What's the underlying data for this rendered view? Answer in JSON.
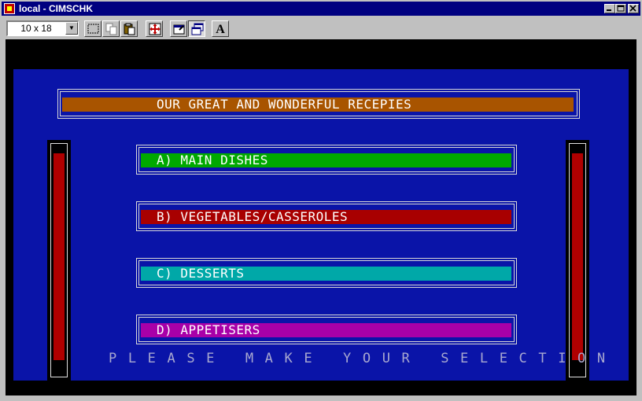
{
  "window": {
    "title": "local - CIMSCHK",
    "controls": [
      "minimize",
      "maximize",
      "close"
    ]
  },
  "toolbar": {
    "font_size_value": "10 x 18",
    "buttons": [
      {
        "name": "mark-icon"
      },
      {
        "name": "copy-icon"
      },
      {
        "name": "paste-icon"
      },
      {
        "name": "full-screen-icon"
      },
      {
        "name": "properties-icon"
      },
      {
        "name": "background-icon"
      },
      {
        "name": "font-icon",
        "glyph": "A"
      }
    ]
  },
  "screen": {
    "header": "OUR GREAT AND WONDERFUL RECEPIES",
    "menu": [
      {
        "label": "A) MAIN DISHES",
        "color": "#00a800"
      },
      {
        "label": "B) VEGETABLES/CASSEROLES",
        "color": "#a80000"
      },
      {
        "label": "C) DESSERTS",
        "color": "#00a8a8"
      },
      {
        "label": "D) APPETISERS",
        "color": "#a800a8"
      }
    ],
    "prompt": "PLEASE MAKE YOUR SELECTION",
    "colors": {
      "background": "#0a14a8",
      "header_bar": "#a85400",
      "side_posts": "#b00000"
    }
  }
}
